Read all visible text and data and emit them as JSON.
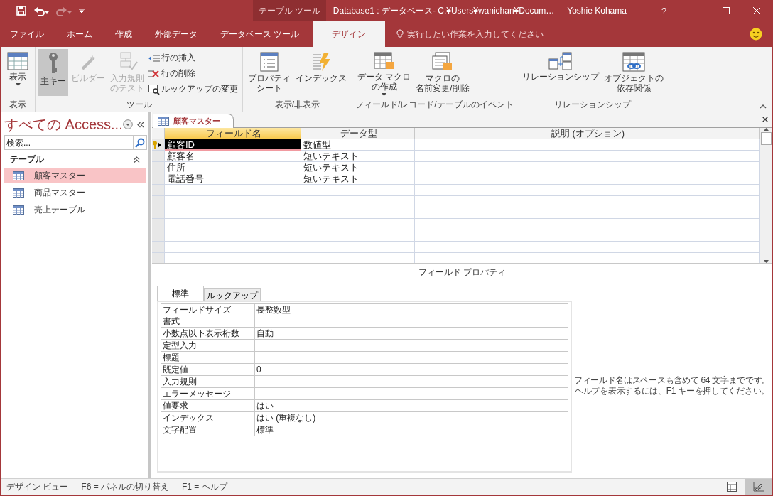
{
  "title_bar": {
    "context_label": "テーブル ツール",
    "title": "Database1 : データベース- C:¥Users¥wanichan¥Docum…",
    "user": "Yoshie Kohama",
    "help": "?"
  },
  "ribbon_tabs": [
    {
      "label": "ファイル",
      "selected": false
    },
    {
      "label": "ホーム",
      "selected": false
    },
    {
      "label": "作成",
      "selected": false
    },
    {
      "label": "外部データ",
      "selected": false
    },
    {
      "label": "データベース ツール",
      "selected": false
    },
    {
      "label": "デザイン",
      "selected": true
    }
  ],
  "tell_me": {
    "placeholder": "実行したい作業を入力してください"
  },
  "ribbon_groups": [
    {
      "label": "表示",
      "buttons": [
        {
          "label": "表示",
          "kind": "large",
          "disabled": false,
          "selected": false,
          "dropdown": true
        }
      ]
    },
    {
      "label": "ツール",
      "buttons": [
        {
          "label": "主キー",
          "kind": "large",
          "disabled": false,
          "selected": true,
          "dropdown": false
        },
        {
          "label": "ビルダー",
          "kind": "large",
          "disabled": true,
          "selected": false,
          "dropdown": false
        },
        {
          "lines": [
            "入力規則",
            "のテスト"
          ],
          "kind": "large",
          "disabled": true,
          "selected": false,
          "dropdown": false
        },
        {
          "label": "行の挿入",
          "kind": "small",
          "disabled": false,
          "selected": false,
          "dropdown": false
        },
        {
          "label": "行の削除",
          "kind": "small",
          "disabled": false,
          "selected": false,
          "dropdown": false
        },
        {
          "label": "ルックアップの変更",
          "kind": "small",
          "disabled": false,
          "selected": false,
          "dropdown": false
        }
      ]
    },
    {
      "label": "表示/非表示",
      "buttons": [
        {
          "lines": [
            "プロパティ",
            "シート"
          ],
          "kind": "large",
          "disabled": false,
          "selected": false,
          "dropdown": false
        },
        {
          "label": "インデックス",
          "kind": "large",
          "disabled": false,
          "selected": false,
          "dropdown": false
        }
      ]
    },
    {
      "label": "フィールド/レコード/テーブルのイベント",
      "buttons": [
        {
          "lines": [
            "データ マクロ",
            "の作成"
          ],
          "kind": "large",
          "disabled": false,
          "selected": false,
          "dropdown": true
        },
        {
          "lines": [
            "マクロの",
            "名前変更/削除"
          ],
          "kind": "large",
          "disabled": false,
          "selected": false,
          "dropdown": false
        }
      ]
    },
    {
      "label": "リレーションシップ",
      "buttons": [
        {
          "label": "リレーションシップ",
          "kind": "large",
          "disabled": false,
          "selected": false,
          "dropdown": false
        },
        {
          "lines": [
            "オブジェクトの",
            "依存関係"
          ],
          "kind": "large",
          "disabled": false,
          "selected": false,
          "dropdown": false
        }
      ]
    }
  ],
  "nav_pane": {
    "title": "すべての Access...",
    "search": {
      "placeholder": "検索..."
    },
    "group": "テーブル",
    "items": [
      {
        "label": "顧客マスター",
        "selected": true
      },
      {
        "label": "商品マスター",
        "selected": false
      },
      {
        "label": "売上テーブル",
        "selected": false
      }
    ]
  },
  "document_tab": {
    "label": "顧客マスター"
  },
  "design_grid": {
    "columns": [
      {
        "label": "フィールド名",
        "selected": true
      },
      {
        "label": "データ型",
        "selected": false
      },
      {
        "label": "説明 (オプション)",
        "selected": false
      }
    ],
    "rows": [
      {
        "field": "顧客ID",
        "type": "数値型",
        "primary_key": true,
        "selected": true
      },
      {
        "field": "顧客名",
        "type": "短いテキスト",
        "primary_key": false,
        "selected": false
      },
      {
        "field": "住所",
        "type": "短いテキスト",
        "primary_key": false,
        "selected": false
      },
      {
        "field": "電話番号",
        "type": "短いテキスト",
        "primary_key": false,
        "selected": false
      }
    ]
  },
  "field_properties": {
    "title": "フィールド プロパティ",
    "tabs": [
      {
        "label": "標準",
        "selected": true
      },
      {
        "label": "ルックアップ",
        "selected": false
      }
    ],
    "properties": [
      {
        "name": "フィールドサイズ",
        "value": "長整数型"
      },
      {
        "name": "書式"
      },
      {
        "name": "小数点以下表示桁数",
        "value": "自動"
      },
      {
        "name": "定型入力"
      },
      {
        "name": "標題"
      },
      {
        "name": "既定値",
        "value": "0"
      },
      {
        "name": "入力規則"
      },
      {
        "name": "エラーメッセージ"
      },
      {
        "name": "値要求",
        "value": "はい"
      },
      {
        "name": "インデックス",
        "value": "はい (重複なし)"
      },
      {
        "name": "文字配置",
        "value": "標準"
      }
    ],
    "help": [
      "フィールド名はスペースも含めて 64 文字までです。",
      "ヘルプを表示するには、F1 キーを押してください。"
    ]
  },
  "status_bar": {
    "texts": [
      "デザイン ビュー",
      "F6 = パネルの切り替え",
      "F1 = ヘルプ"
    ],
    "views": [
      {
        "selected": false
      },
      {
        "selected": true
      }
    ]
  }
}
